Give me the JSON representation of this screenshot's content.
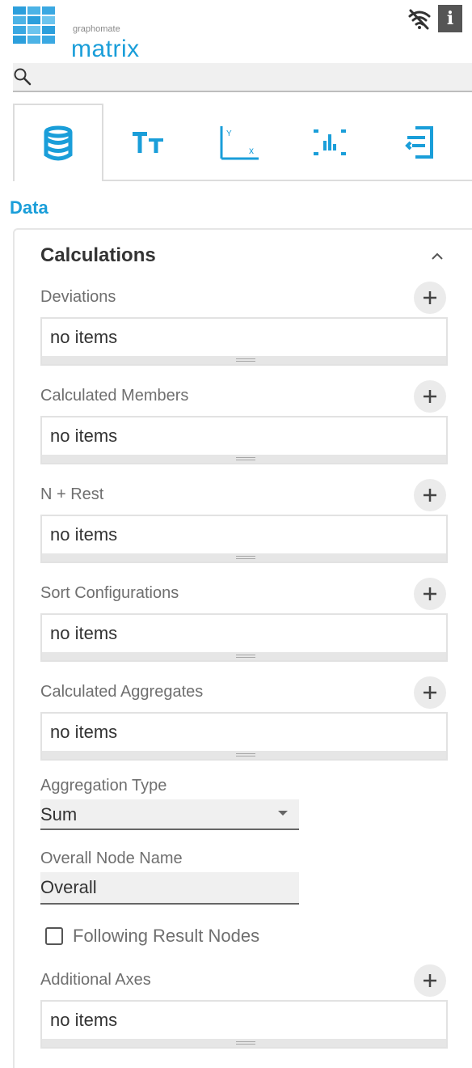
{
  "header": {
    "logo_small": "graphomate",
    "logo_big": "matrix",
    "info_label": "i",
    "icons": {
      "wifi": "wifi-off-icon",
      "info": "info-icon"
    }
  },
  "search": {
    "value": "",
    "placeholder": "",
    "icon": "search-icon"
  },
  "tabs": [
    {
      "id": "data",
      "icon": "database-icon",
      "active": true
    },
    {
      "id": "text",
      "icon": "text-format-icon",
      "active": false
    },
    {
      "id": "axes",
      "icon": "axis-chart-icon",
      "active": false
    },
    {
      "id": "layout",
      "icon": "chart-frame-icon",
      "active": false
    },
    {
      "id": "export",
      "icon": "export-icon",
      "active": false
    }
  ],
  "section": {
    "title": "Data"
  },
  "panel": {
    "title": "Calculations",
    "lists": [
      {
        "label": "Deviations",
        "content": "no items"
      },
      {
        "label": "Calculated Members",
        "content": "no items"
      },
      {
        "label": "N + Rest",
        "content": "no items"
      },
      {
        "label": "Sort Configurations",
        "content": "no items"
      },
      {
        "label": "Calculated Aggregates",
        "content": "no items"
      }
    ],
    "aggregation": {
      "label": "Aggregation Type",
      "value": "Sum"
    },
    "overall_node": {
      "label": "Overall Node Name",
      "value": "Overall"
    },
    "following_results": {
      "label": "Following Result Nodes",
      "checked": false
    },
    "additional_axes": {
      "label": "Additional Axes",
      "content": "no items"
    }
  },
  "colors": {
    "accent": "#1a9ed9",
    "text": "#333333",
    "muted": "#6f6f6f"
  }
}
